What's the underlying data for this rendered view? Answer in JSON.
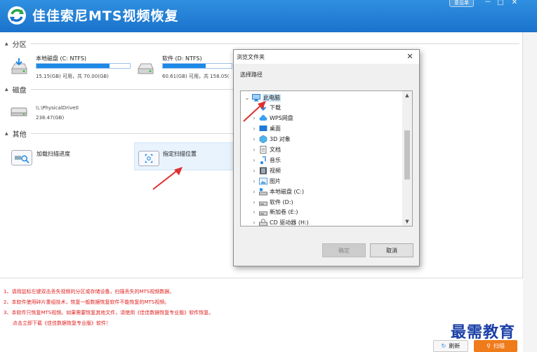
{
  "app": {
    "title": "佳佳索尼MTS视频恢复",
    "feedback_label": "意见单"
  },
  "window_controls": {
    "minimize": "－",
    "maximize": "□",
    "close": "✕"
  },
  "sections": {
    "partitions": "分区",
    "disks": "磁盘",
    "other": "其他"
  },
  "partitions": [
    {
      "name": "本地磁盘 (C: NTFS)",
      "info": "15.15(GB) 可用，共 70.00(GB)",
      "used_fraction": 0.78
    },
    {
      "name": "软件 (D: NTFS)",
      "info": "60.61(GB) 可用，共 158.05(",
      "used_fraction": 0.62
    }
  ],
  "disks": [
    {
      "name": "\\\\.\\PhysicalDrive0",
      "info": "238.47(GB)"
    }
  ],
  "other_items": [
    {
      "label": "加载扫描进度"
    },
    {
      "label": "指定扫描位置"
    }
  ],
  "notes": [
    "1、请用鼠标左键双击丢失视频的分区或存储设备，扫描丢失的MTS视频数据。",
    "2、本软件使用碎片重组技术，恢复一般数据恢复软件不能恢复的MTS视频。",
    "3、本软件只恢复MTS视频。如果需要恢复其他文件，请使用《佳佳数据恢复专业版》软件恢复。",
    "点击立即下载《佳佳数据恢复专业版》软件！"
  ],
  "buttons": {
    "refresh": "刷新",
    "scan": "扫描"
  },
  "watermark": "最需教育",
  "dialog": {
    "title": "浏览文件夹",
    "close": "✕",
    "prompt": "选择路径",
    "tree": [
      {
        "label": "此电脑",
        "chev": "⌄",
        "icon": "computer-icon",
        "level": 0,
        "selected": true
      },
      {
        "label": "下载",
        "chev": "",
        "icon": "download-icon",
        "level": 1
      },
      {
        "label": "WPS网盘",
        "chev": "›",
        "icon": "cloud-icon",
        "level": 1
      },
      {
        "label": "桌面",
        "chev": "›",
        "icon": "desktop-icon",
        "level": 1
      },
      {
        "label": "3D 对象",
        "chev": "›",
        "icon": "cube-icon",
        "level": 1
      },
      {
        "label": "文档",
        "chev": "›",
        "icon": "document-icon",
        "level": 1
      },
      {
        "label": "音乐",
        "chev": "›",
        "icon": "music-icon",
        "level": 1
      },
      {
        "label": "视频",
        "chev": "›",
        "icon": "video-icon",
        "level": 1
      },
      {
        "label": "图片",
        "chev": "›",
        "icon": "picture-icon",
        "level": 1
      },
      {
        "label": "本地磁盘 (C:)",
        "chev": "›",
        "icon": "windows-drive-icon",
        "level": 1
      },
      {
        "label": "软件 (D:)",
        "chev": "›",
        "icon": "drive-icon",
        "level": 1
      },
      {
        "label": "新加卷 (E:)",
        "chev": "›",
        "icon": "drive-icon",
        "level": 1
      },
      {
        "label": "CD 驱动器 (H:)",
        "chev": "›",
        "icon": "cd-drive-icon",
        "level": 1
      }
    ],
    "ok_label": "确定",
    "cancel_label": "取消"
  },
  "colors": {
    "titlebar": "#1b73cc",
    "accent_orange": "#f07b1a",
    "note_red": "#e02020",
    "watermark": "#1a3fa6",
    "arrow_red": "#e03030"
  }
}
